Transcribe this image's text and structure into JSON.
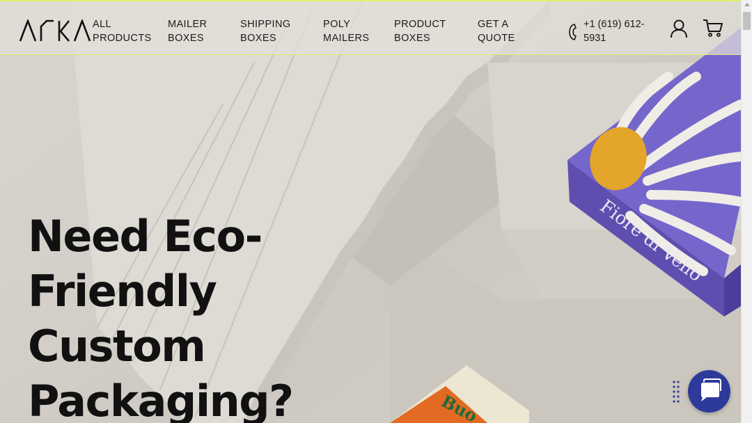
{
  "brand": {
    "logo_text": "ARKA"
  },
  "nav": {
    "items": [
      {
        "label": "ALL\nPRODUCTS"
      },
      {
        "label": "MAILER\nBOXES"
      },
      {
        "label": "SHIPPING\nBOXES"
      },
      {
        "label": "POLY\nMAILERS"
      },
      {
        "label": "PRODUCT\nBOXES"
      },
      {
        "label": "GET A\nQUOTE"
      }
    ]
  },
  "contact": {
    "phone": "+1 (619) 612-5931"
  },
  "icons": {
    "phone": "phone-icon",
    "account": "user-icon",
    "cart": "cart-icon",
    "chat": "chat-icon",
    "handle": "drag-handle-icon"
  },
  "hero": {
    "title": "Need Eco-Friendly Custom Packaging?",
    "box_label_purple": "Fiore di Vello",
    "box_label_cream": "Buo"
  },
  "colors": {
    "accent_line": "#e6ef6a",
    "chat_bg": "#2d3a9a",
    "box_purple": "#6a58c2",
    "box_yellow": "#e3a52a",
    "box_orange": "#e26a22"
  }
}
